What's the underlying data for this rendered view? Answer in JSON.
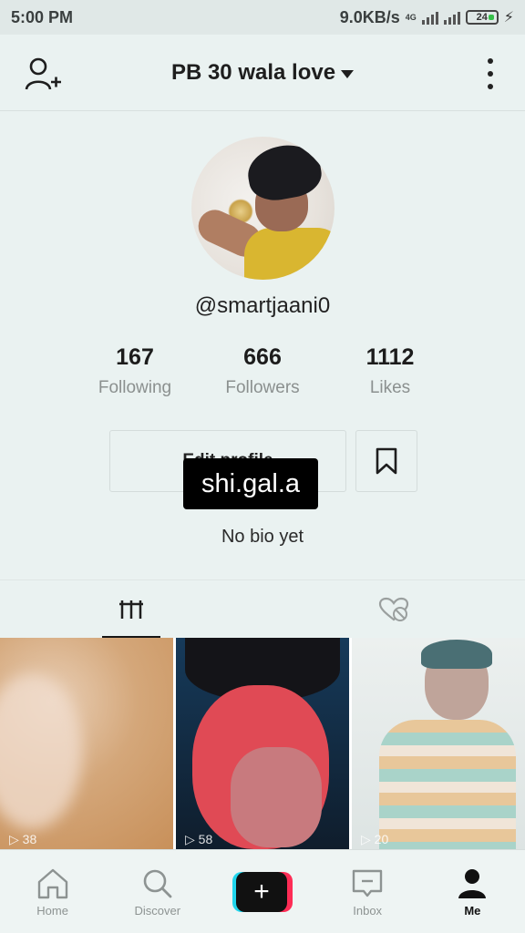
{
  "status": {
    "time": "5:00 PM",
    "speed": "9.0KB/s",
    "network": "4G",
    "battery": "24"
  },
  "header": {
    "title": "PB 30 wala love"
  },
  "profile": {
    "username": "@smartjaani0",
    "stats": [
      {
        "value": "167",
        "label": "Following"
      },
      {
        "value": "666",
        "label": "Followers"
      },
      {
        "value": "1112",
        "label": "Likes"
      }
    ],
    "edit_label": "Edit profile",
    "bio": "No bio yet"
  },
  "overlay": {
    "text": "shi.gal.a"
  },
  "videos": [
    {
      "views": "38"
    },
    {
      "views": "58"
    },
    {
      "views": "20"
    }
  ],
  "bottom_nav": [
    {
      "label": "Home",
      "icon": "home-icon"
    },
    {
      "label": "Discover",
      "icon": "search-icon"
    },
    {
      "label": "",
      "icon": "plus-icon"
    },
    {
      "label": "Inbox",
      "icon": "inbox-icon"
    },
    {
      "label": "Me",
      "icon": "profile-icon"
    }
  ],
  "colors": {
    "accent_cyan": "#20d5ec",
    "accent_red": "#fe2c55",
    "background": "#eaf2f1"
  }
}
